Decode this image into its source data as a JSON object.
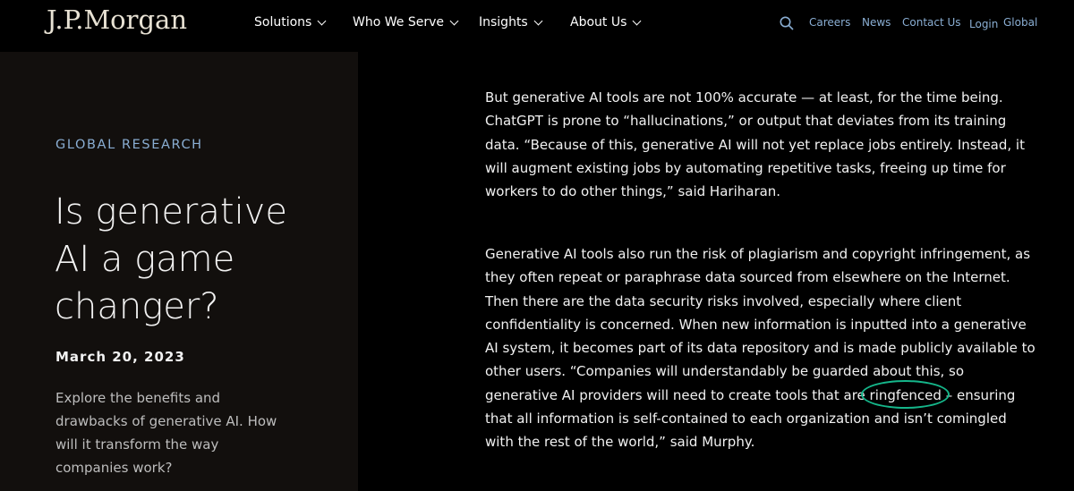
{
  "header": {
    "logo": "J.P.Morgan",
    "nav": [
      "Solutions",
      "Who We Serve",
      "Insights",
      "About Us"
    ],
    "utility": {
      "careers": "Careers",
      "news": "News",
      "contact": "Contact Us",
      "login": "Login",
      "global": "Global"
    }
  },
  "sidebar": {
    "eyebrow": "GLOBAL RESEARCH",
    "title_line1": "Is generative",
    "title_line2": "AI a game",
    "title_line3": "changer?",
    "date": "March 20, 2023",
    "summary": "Explore the benefits and drawbacks of generative AI. How will it transform the way companies work?"
  },
  "article": {
    "paragraph1": "But generative AI tools are not 100% accurate — at least, for the time being. ChatGPT is prone to “hallucinations,” or output that deviates from its training data. “Because of this, generative AI will not yet replace jobs entirely. Instead, it will augment existing jobs by automating repetitive tasks, freeing up time for workers to do other things,” said Hariharan.",
    "paragraph2_before": "Generative AI tools also run the risk of plagiarism and copyright infringement, as they often repeat or paraphrase data sourced from elsewhere on the Internet. Then there are the data security risks involved, especially where client confidentiality is concerned. When new information is inputted into a generative AI system, it becomes part of its data repository and is made publicly available to other users. “Companies will understandably be guarded about this, so generative AI providers will need to create tools that are ",
    "paragraph2_highlight": "ringfenced",
    "paragraph2_after": " – ensuring that all information is self-contained to each organization and isn’t comingled with the rest of the world,” said Murphy.",
    "highlight_color": "#15b68a"
  }
}
